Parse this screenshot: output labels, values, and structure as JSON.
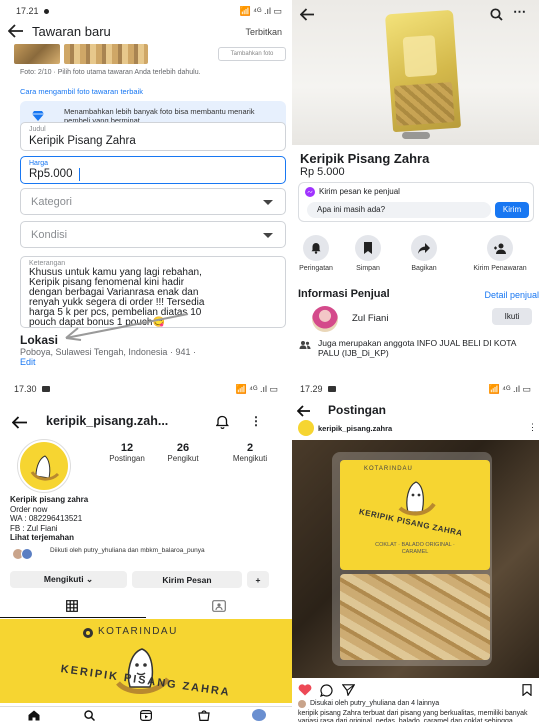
{
  "p1": {
    "status_time": "17.21",
    "status_icons": "📶 ⁴ᴳ .ıl ▭",
    "title": "Tawaran baru",
    "publish": "Terbitkan",
    "photo_tag": "Tambahkan foto",
    "photo_note": "Foto: 2/10 · Pilih foto utama tawaran Anda terlebih dahulu.",
    "photo_link": "Cara mengambil foto tawaran terbaik",
    "tip": "Menambahkan lebih banyak foto bisa membantu menarik pembeli yang berminat.",
    "title_label": "Judul",
    "title_value": "Keripik Pisang Zahra",
    "price_label": "Harga",
    "price_value": "Rp5.000",
    "category_ph": "Kategori",
    "condition_ph": "Kondisi",
    "desc_label": "Keterangan",
    "desc_lines": [
      "Khusus untuk kamu yang lagi rebahan,",
      "Keripik pisang fenomenal kini hadir",
      "dengan berbagai Varianrasa enak dan",
      "renyah yukk segera di order !!! Tersedia",
      "harga 5 k per pcs, pembelian diatas 10",
      "pouch dapat bonus 1 pouch😋"
    ],
    "location_head": "Lokasi",
    "location_value": "Poboya, Sulawesi Tengah, Indonesia · 941 ·",
    "location_edit": "Edit"
  },
  "p2": {
    "product": "Keripik Pisang Zahra",
    "price": "Rp 5.000",
    "msg_title": "Kirim pesan ke penjual",
    "msg_input": "Apa ini masih ada?",
    "send": "Kirim",
    "actions": [
      "Peringatan",
      "Simpan",
      "Bagikan",
      "Kirim Penawaran"
    ],
    "seller_head": "Informasi Penjual",
    "seller_link": "Detail penjual",
    "seller_name": "Zul Fiani",
    "follow": "Ikuti",
    "group_note": "Juga merupakan anggota INFO JUAL BELI DI KOTA PALU (IJB_Di_KP)"
  },
  "p3": {
    "status_time": "17.30",
    "status_icons": "📶 ⁴ᴳ .ıl ▭",
    "username": "keripik_pisang.zah...",
    "stats": [
      {
        "n": "12",
        "l": "Postingan"
      },
      {
        "n": "26",
        "l": "Pengikut"
      },
      {
        "n": "2",
        "l": "Mengikuti"
      }
    ],
    "bio_name": "Keripik pisang zahra",
    "bio_lines": [
      "Order now",
      "WA : 082296413521",
      "FB : Zul Fiani"
    ],
    "bio_more": "Lihat terjemahan",
    "followed_by": "Diikuti oleh putry_yhuliana dan mbkm_balaroa_punya",
    "btn_following": "Mengikuti ⌄",
    "btn_message": "Kirim Pesan",
    "btn_add": "+",
    "post_brand": "KOTARINDAU",
    "post_text": "KERIPIK PISANG ZAHRA"
  },
  "p4": {
    "status_time": "17.29",
    "status_icons": "📶 ⁴ᴳ .ıl ▭",
    "title": "Postingan",
    "account": "keripik_pisang.zahra",
    "label_title": "KERIPIK PISANG ZAHRA",
    "label_brand": "KOTARINDAU",
    "label_flavors": "COKLAT · BALADO ORIGINAL · CARAMEL",
    "likes": "Disukai oleh putry_yhuliana dan 4 lainnya",
    "caption_user": "keripik_pisang.zahra",
    "caption": "keripik pisang Zahra terbuat dari pisang yang berkualitas, memiliki banyak variasi rasa dari original, pedas, balado, caramel dan coklat sehingga membuat lidah tidak merasa bosan. Mumpung masih hangat nih, order sekarang yukk ! kirimkan alamatmu, pesanan keripik pisang Zahra akan segera menuju rumahmu !!!"
  },
  "colors": {
    "fb_blue": "#1877f2",
    "yellow": "#f6d531",
    "heart": "#ed4956"
  }
}
